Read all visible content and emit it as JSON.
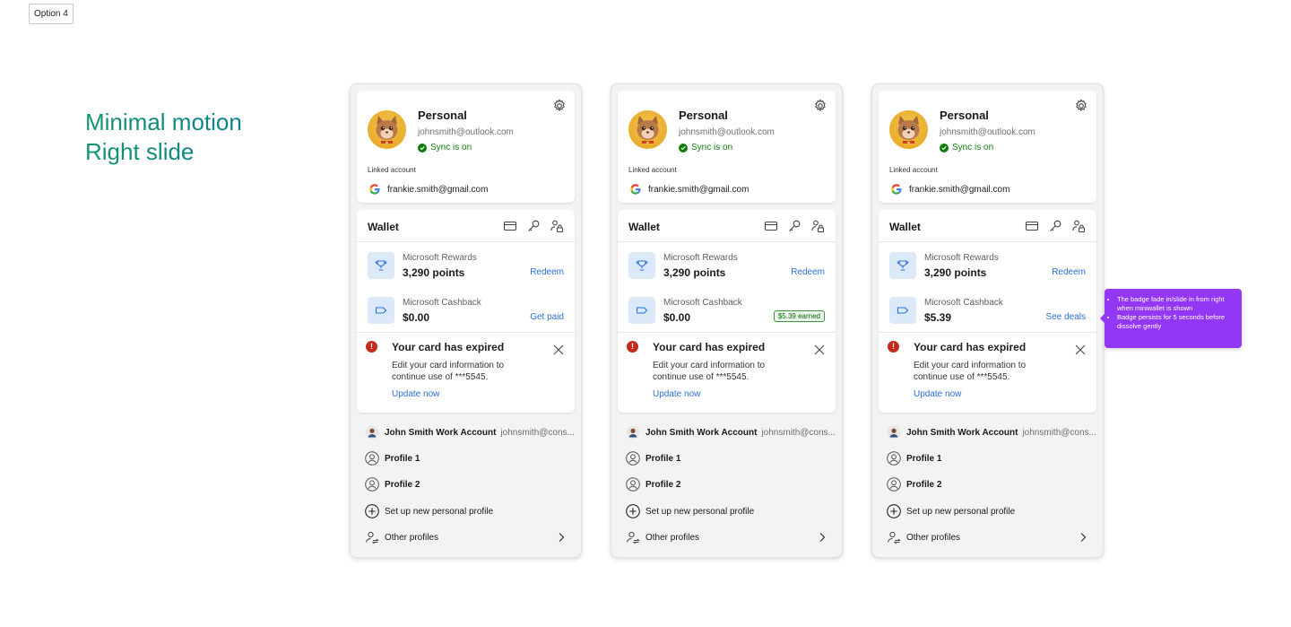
{
  "option_label": "Option 4",
  "heading": {
    "line1": "Minimal motion",
    "line2": "Right slide"
  },
  "colors": {
    "accent_link": "#2a6fdb",
    "sync_green": "#107c10",
    "alert_red": "#c42b1c",
    "tooltip_purple": "#9237f5",
    "heading_green": "#12966c"
  },
  "panels": [
    {
      "profile": {
        "name": "Personal",
        "email": "johnsmith@outlook.com",
        "sync": "Sync is on",
        "linked_label": "Linked account",
        "linked_email": "frankie.smith@gmail.com"
      },
      "wallet": {
        "title": "Wallet",
        "rewards": {
          "label": "Microsoft Rewards",
          "value": "3,290 points",
          "link": "Redeem"
        },
        "cashback": {
          "label": "Microsoft Cashback",
          "value": "$0.00",
          "link": "Get paid",
          "badge": ""
        }
      },
      "alert": {
        "title": "Your card has expired",
        "text": "Edit your card information to continue use of ***5545.",
        "link": "Update now"
      },
      "accounts": {
        "work_name": "John Smith Work Account",
        "work_email": "johnsmith@cons...",
        "profile1": "Profile 1",
        "profile2": "Profile 2",
        "new_profile": "Set up new personal profile",
        "other": "Other profiles"
      }
    },
    {
      "profile": {
        "name": "Personal",
        "email": "johnsmith@outlook.com",
        "sync": "Sync is on",
        "linked_label": "Linked account",
        "linked_email": "frankie.smith@gmail.com"
      },
      "wallet": {
        "title": "Wallet",
        "rewards": {
          "label": "Microsoft Rewards",
          "value": "3,290 points",
          "link": "Redeem"
        },
        "cashback": {
          "label": "Microsoft Cashback",
          "value": "$0.00",
          "link": "",
          "badge": "$5.39 earned"
        }
      },
      "alert": {
        "title": "Your card has expired",
        "text": "Edit your card information to continue use of ***5545.",
        "link": "Update now"
      },
      "accounts": {
        "work_name": "John Smith Work Account",
        "work_email": "johnsmith@cons...",
        "profile1": "Profile 1",
        "profile2": "Profile 2",
        "new_profile": "Set up new personal profile",
        "other": "Other profiles"
      }
    },
    {
      "profile": {
        "name": "Personal",
        "email": "johnsmith@outlook.com",
        "sync": "Sync is on",
        "linked_label": "Linked account",
        "linked_email": "frankie.smith@gmail.com"
      },
      "wallet": {
        "title": "Wallet",
        "rewards": {
          "label": "Microsoft Rewards",
          "value": "3,290 points",
          "link": "Redeem"
        },
        "cashback": {
          "label": "Microsoft Cashback",
          "value": "$5.39",
          "link": "See deals",
          "badge": ""
        }
      },
      "alert": {
        "title": "Your card has expired",
        "text": "Edit your card information to continue use of ***5545.",
        "link": "Update now"
      },
      "accounts": {
        "work_name": "John Smith Work Account",
        "work_email": "johnsmith@cons...",
        "profile1": "Profile 1",
        "profile2": "Profile 2",
        "new_profile": "Set up new personal profile",
        "other": "Other profiles"
      }
    }
  ],
  "tooltip": {
    "items": [
      "The badge fade in/slide in from right when miniwallet is shown",
      "Badge persists for 5 seconds before dissolve gently"
    ]
  }
}
